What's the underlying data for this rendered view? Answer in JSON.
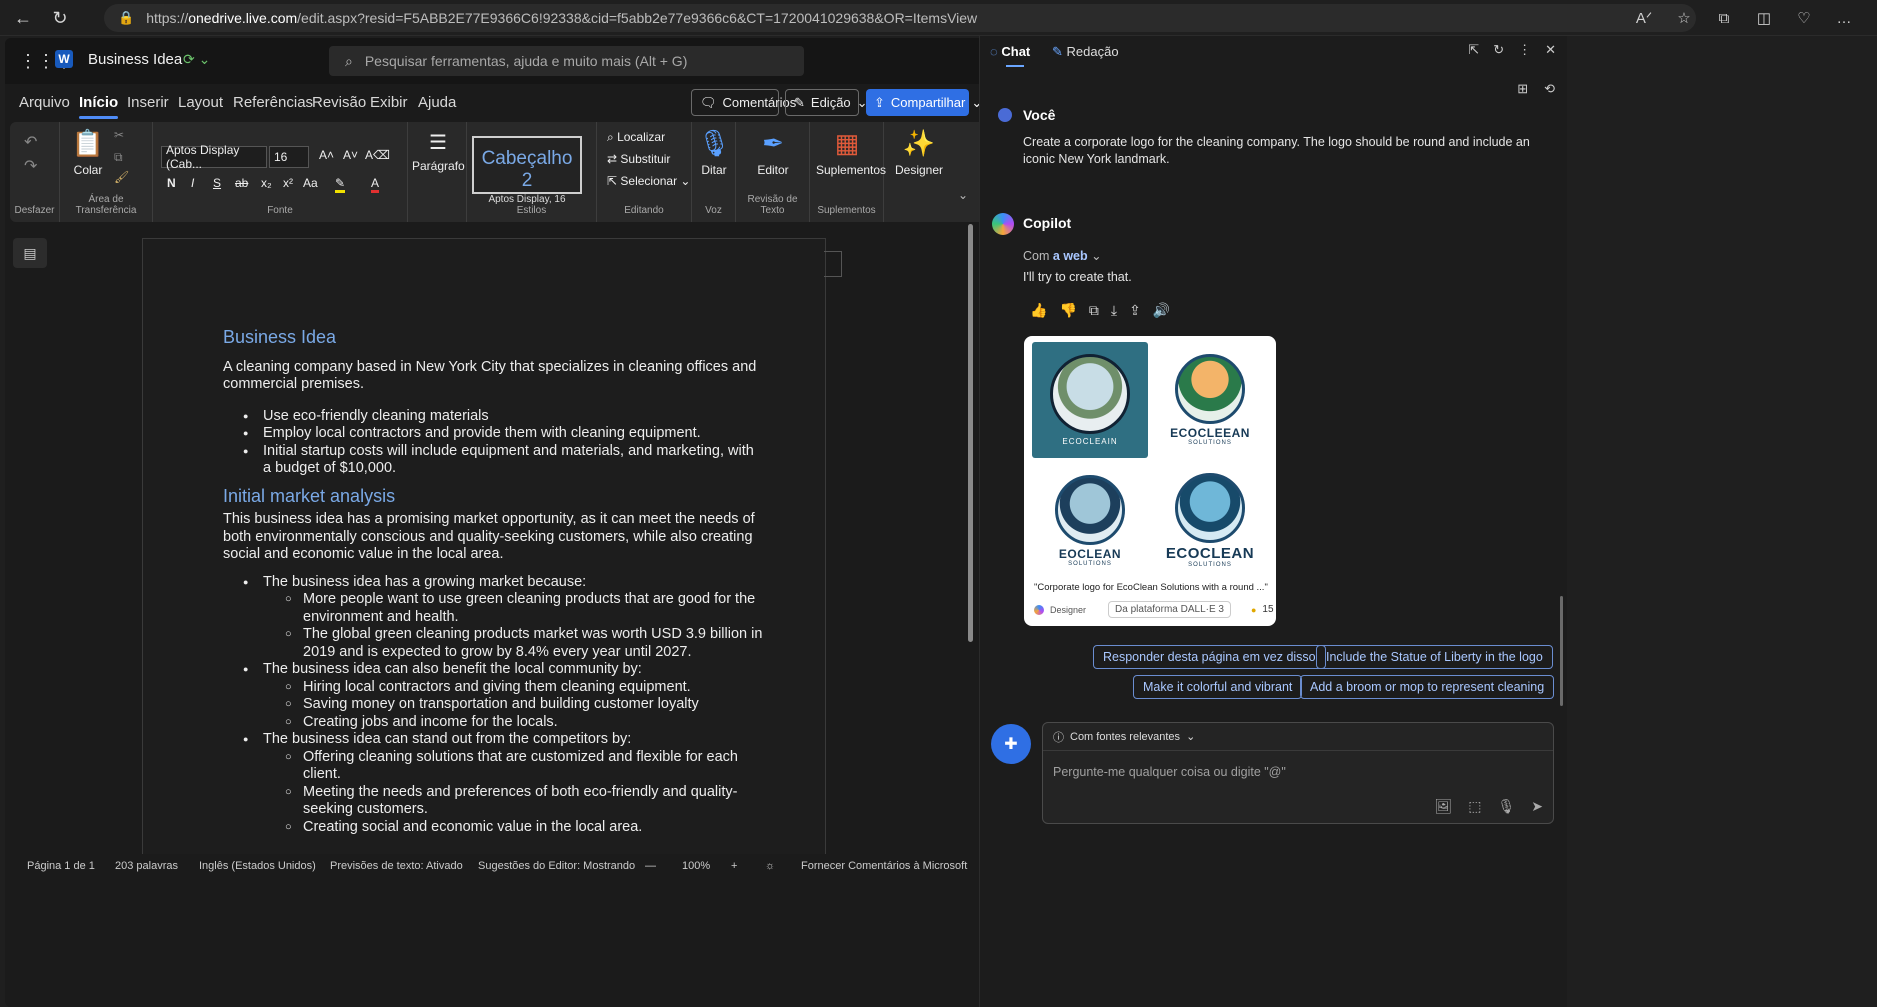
{
  "browser": {
    "url_prefix": "https://",
    "url_host": "onedrive.live.com",
    "url_rest": "/edit.aspx?resid=F5ABB2E77E9366C6!92338&cid=f5abb2e77e9366c6&CT=1720041029638&OR=ItemsView"
  },
  "word": {
    "doc_title": "Business Idea",
    "search_placeholder": "Pesquisar ferramentas, ajuda e muito mais (Alt + G)",
    "menu": [
      "Arquivo",
      "Início",
      "Inserir",
      "Layout",
      "Referências",
      "Revisão",
      "Exibir",
      "Ajuda"
    ],
    "comments_btn": "Comentários",
    "edit_btn": "Edição",
    "share_btn": "Compartilhar",
    "ribbon": {
      "undo_label": "Desfazer",
      "paste": "Colar",
      "clipboard_label": "Área de Transferência",
      "font_name": "Aptos Display (Cab...",
      "font_size": "16",
      "font_label": "Fonte",
      "paragraph": "Parágrafo",
      "style_name": "Cabeçalho 2",
      "style_font": "Aptos Display, 16",
      "styles_label": "Estilos",
      "find": "Localizar",
      "replace": "Substituir",
      "select": "Selecionar",
      "editing_label": "Editando",
      "dictate": "Ditar",
      "voice_label": "Voz",
      "editor": "Editor",
      "text_review_label": "Revisão de Texto",
      "addins": "Suplementos",
      "addins_label": "Suplementos",
      "designer": "Designer"
    },
    "document": {
      "heading1": "Business Idea",
      "intro": "A cleaning company based in New York City that specializes in cleaning offices and commercial premises.",
      "bullets1": [
        "Use eco-friendly cleaning materials",
        "Employ local contractors and provide them with cleaning equipment.",
        "Initial startup costs will include equipment and materials, and marketing, with a budget of $10,000."
      ],
      "heading2": "Initial market analysis",
      "analysis": "This business idea has a promising market opportunity, as it can meet the needs of both environmentally conscious and quality-seeking customers, while also creating social and economic value in the local area.",
      "b_growing": "The business idea has a growing market because:",
      "b_growing_sub": [
        "More people want to use green cleaning products that are good for the environment and health.",
        "The global green cleaning products market was worth USD 3.9 billion in 2019 and is expected to grow by 8.4% every year until 2027."
      ],
      "b_community": "The business idea can also benefit the local community by:",
      "b_community_sub": [
        "Hiring local contractors and giving them cleaning equipment.",
        "Saving money on transportation and building customer loyalty",
        "Creating jobs and income for the locals."
      ],
      "b_standout": "The business idea can stand out from the competitors by:",
      "b_standout_sub": [
        "Offering cleaning solutions that are customized and flexible for each client.",
        "Meeting the needs and preferences of both eco-friendly and quality-seeking customers.",
        "Creating social and economic value in the local area."
      ]
    },
    "status": {
      "page": "Página 1 de 1",
      "words": "203 palavras",
      "lang": "Inglês (Estados Unidos)",
      "predictions": "Previsões de texto: Ativado",
      "suggestions": "Sugestões do Editor: Mostrando",
      "zoom": "100%",
      "feedback": "Fornecer Comentários à Microsoft"
    }
  },
  "copilot": {
    "tab_chat": "Chat",
    "tab_compose": "Redação",
    "user_name": "Você",
    "user_msg": "Create a corporate logo for the cleaning company. The logo should be round and include an iconic New York landmark.",
    "bot_name": "Copilot",
    "with_prefix": "Com",
    "with_web": "a web",
    "bot_reply": "I'll try to create that.",
    "logo_text": "ECOCLEEAN",
    "logo_sub": "SOLUTIONS",
    "logo_text2": "EOCLEAN",
    "logo_text3": "ECOCLEAN",
    "logo_arc": "ECOCLEAIN",
    "image_caption": "\"Corporate logo for EcoClean Solutions with a round ...\"",
    "designer_label": "Designer",
    "platform_label": "Da plataforma DALL·E 3",
    "credits": "15",
    "suggestions": [
      "Responder desta página em vez disso",
      "Include the Statue of Liberty in the logo",
      "Make it colorful and vibrant",
      "Add a broom or mop to represent cleaning"
    ],
    "sources_label": "Com fontes relevantes",
    "input_placeholder": "Pergunte-me qualquer coisa ou digite \"@\""
  }
}
